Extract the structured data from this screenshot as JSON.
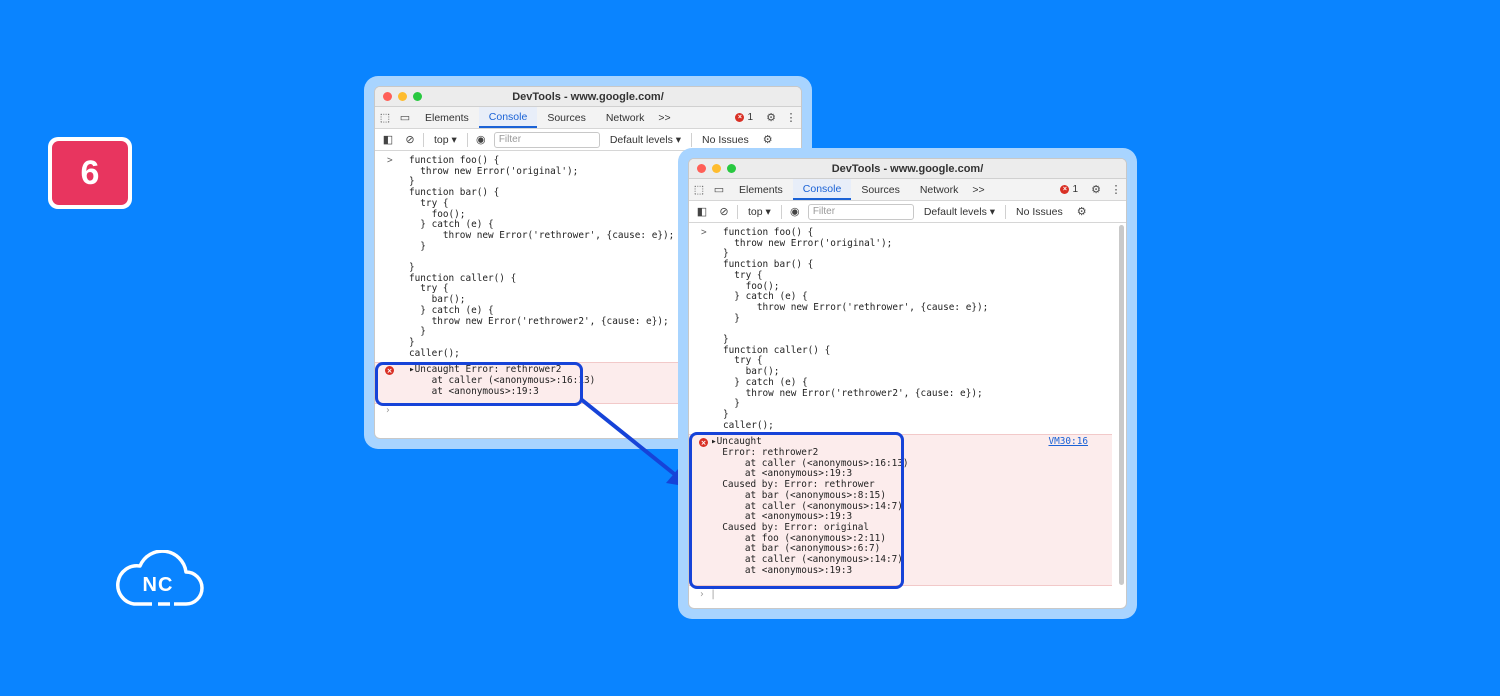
{
  "badge": {
    "number": "6"
  },
  "logo": {
    "text": "NC"
  },
  "colors": {
    "background": "#0a84ff",
    "badge": "#e8355f",
    "highlight": "#1643d8"
  },
  "devtools": {
    "title": "DevTools - www.google.com/",
    "tabs": [
      "Elements",
      "Console",
      "Sources",
      "Network"
    ],
    "more_tabs": ">>",
    "error_count": "1",
    "context": "top",
    "filter_placeholder": "Filter",
    "levels": "Default levels",
    "issues": "No Issues"
  },
  "code_lines": [
    "function foo() {",
    "  throw new Error('original');",
    "}",
    "function bar() {",
    "  try {",
    "    foo();",
    "  } catch (e) {",
    "      throw new Error('rethrower', {cause: e});",
    "  }",
    "",
    "}",
    "function caller() {",
    "  try {",
    "    bar();",
    "  } catch (e) {",
    "    throw new Error('rethrower2', {cause: e});",
    "  }",
    "}",
    "caller();"
  ],
  "left_error": [
    "Uncaught Error: rethrower2",
    "  at caller (<anonymous>:16:13)",
    "  at <anonymous>:19:3"
  ],
  "right_error": {
    "source": "VM30:16",
    "lines": [
      "Uncaught",
      "Error: rethrower2",
      "    at caller (<anonymous>:16:13)",
      "    at <anonymous>:19:3",
      "Caused by: Error: rethrower",
      "    at bar (<anonymous>:8:15)",
      "    at caller (<anonymous>:14:7)",
      "    at <anonymous>:19:3",
      "Caused by: Error: original",
      "    at foo (<anonymous>:2:11)",
      "    at bar (<anonymous>:6:7)",
      "    at caller (<anonymous>:14:7)",
      "    at <anonymous>:19:3"
    ]
  }
}
